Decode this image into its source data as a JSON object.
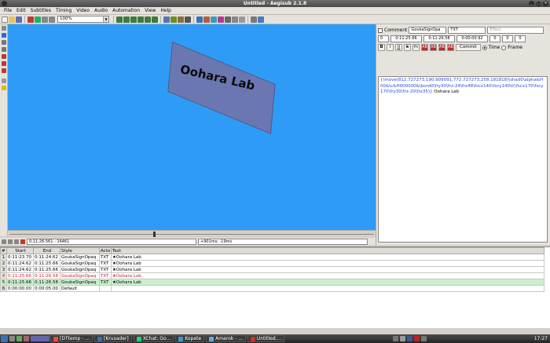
{
  "window": {
    "title": "Untitled - Aegisub 2.1.8"
  },
  "menu": [
    "File",
    "Edit",
    "Subtitles",
    "Timing",
    "Video",
    "Audio",
    "Automation",
    "View",
    "Help"
  ],
  "toolbar": {
    "zoom": "100%"
  },
  "video": {
    "sign_text": "Oohara Lab",
    "background": "#2e9cf6"
  },
  "video_controls": {
    "time_frame": "0:11:26.561 - 16461",
    "offset": "+901ms; -19ms"
  },
  "editor": {
    "comment_label": "Comment",
    "style": "GoukaSignOpa",
    "actor": "TXT",
    "effect_placeholder": "Effect",
    "layer": "0",
    "start": "0:11:25.66",
    "end": "0:11:26.58",
    "duration": "0:00:00.92",
    "margin_l": "0",
    "margin_r": "0",
    "margin_v": "0",
    "format_buttons": [
      "B",
      "I",
      "U",
      "S",
      "fn",
      "AB",
      "AB",
      "AB",
      "AB"
    ],
    "commit_label": "Commit",
    "time_label": "Time",
    "frame_label": "Frame",
    "text_segments": [
      {
        "t": "{\\move(812.727273,190.909091,772.727273,258.181818)\\shad0\\",
        "k": "tag"
      },
      {
        "t": "alpha&H00&\\c&H000000&\\bord0\\fry30\\frz-24\\frx48\\fscx140\\fscy140\\t",
        "k": "tag"
      },
      {
        "t": "(\\fscx170\\fscy170\\fry30\\frz-20\\frx35)}",
        "k": "tag"
      },
      {
        "t": "Oohara Lab",
        "k": "plain"
      }
    ]
  },
  "grid": {
    "headers": [
      "#",
      "Start",
      "End",
      "Style",
      "Acto",
      "Text"
    ],
    "rows": [
      {
        "n": "1",
        "start": "0:11:23.70",
        "end": "0:11:24.62",
        "style": "GoukaSignOpaq",
        "actor": "TXT",
        "text": "★Oohara Lab",
        "state": "normal"
      },
      {
        "n": "2",
        "start": "0:11:24.62",
        "end": "0:11:25.66",
        "style": "GoukaSignOpaq",
        "actor": "TXT",
        "text": "★Oohara Lab",
        "state": "normal"
      },
      {
        "n": "3",
        "start": "0:11:24.62",
        "end": "0:11:25.66",
        "style": "GoukaSignOpaq",
        "actor": "TXT",
        "text": "★Oohara Lab",
        "state": "normal"
      },
      {
        "n": "4",
        "start": "0:11:25.66",
        "end": "0:11:26.58",
        "style": "GoukaSignOpaq",
        "actor": "TXT",
        "text": "★Oohara Lab",
        "state": "red"
      },
      {
        "n": "5",
        "start": "0:11:25.66",
        "end": "0:11:26.58",
        "style": "GoukaSignOpaq",
        "actor": "TXT",
        "text": "★Oohara Lab",
        "state": "selected"
      },
      {
        "n": "6",
        "start": "0:00:00.00",
        "end": "0:00:05.00",
        "style": "Default",
        "actor": "",
        "text": "",
        "state": "normal"
      }
    ]
  },
  "taskbar": {
    "tasks": [
      "[DTtemp - ...",
      "[Krusader]",
      "XChat: Go...",
      "Kopete",
      "Amarok - ...",
      "Untitled...."
    ],
    "clock": "17:27"
  }
}
